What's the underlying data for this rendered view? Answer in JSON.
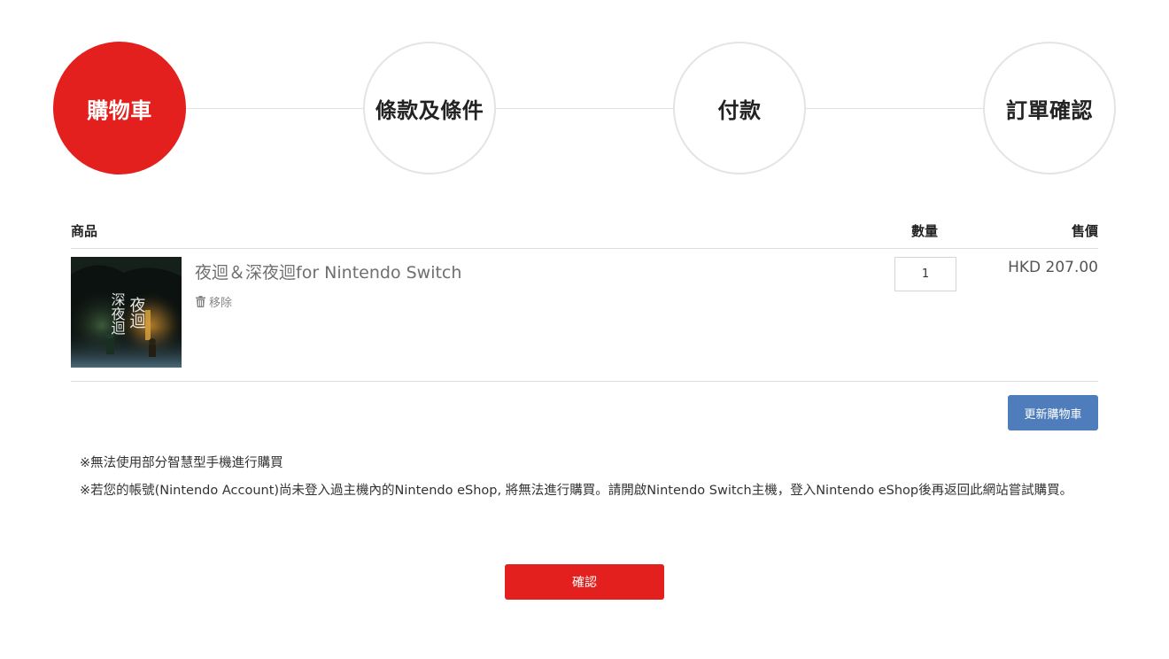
{
  "steps": [
    {
      "label": "購物車",
      "active": true
    },
    {
      "label": "條款及條件",
      "active": false
    },
    {
      "label": "付款",
      "active": false
    },
    {
      "label": "訂單確認",
      "active": false
    }
  ],
  "cart": {
    "headers": {
      "product": "商品",
      "quantity": "數量",
      "price": "售價"
    },
    "items": [
      {
        "title": "夜迴＆深夜迴for Nintendo Switch",
        "remove_label": "移除",
        "quantity": "1",
        "price": "HKD 207.00",
        "thumb_text": "夜迴 深夜迴"
      }
    ],
    "update_label": "更新購物車"
  },
  "notes": [
    "※無法使用部分智慧型手機進行購買",
    "※若您的帳號(Nintendo Account)尚未登入過主機內的Nintendo eShop, 將無法進行購買。請開啟Nintendo Switch主機，登入Nintendo eShop後再返回此網站嘗試購買。"
  ],
  "confirm_label": "確認",
  "colors": {
    "accent": "#e3201d",
    "update_button": "#4f7dbb"
  },
  "icons": {
    "remove": "trash-icon"
  }
}
